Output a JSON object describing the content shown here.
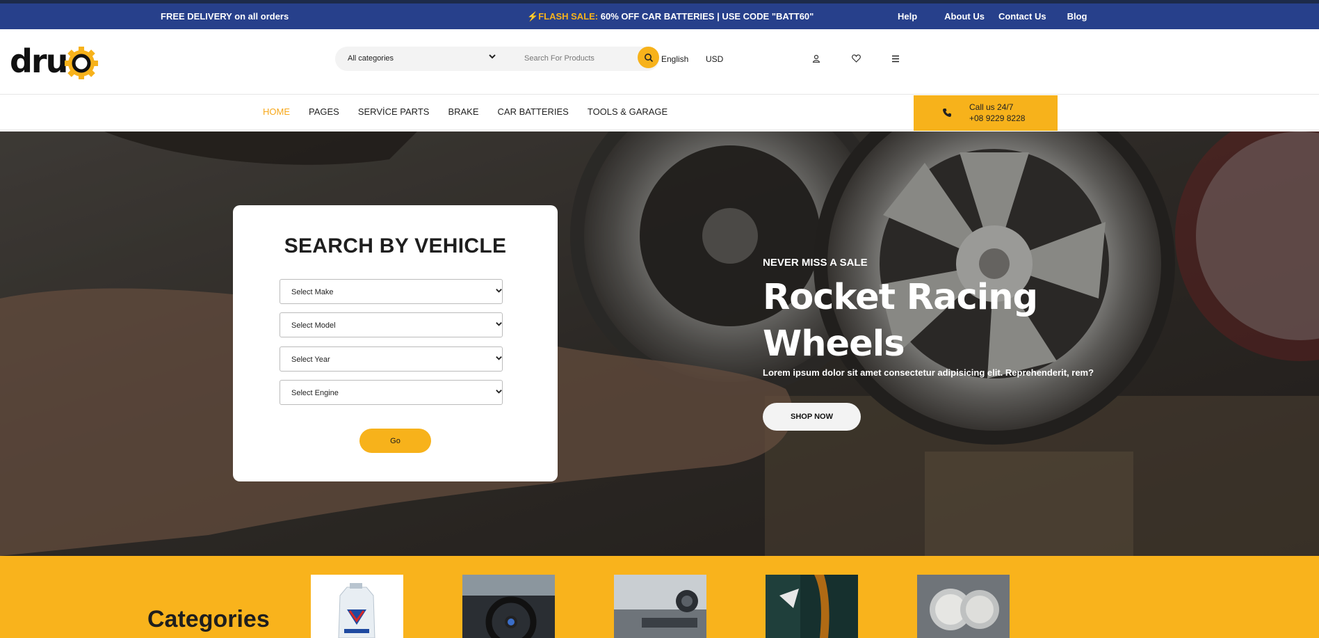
{
  "topbar": {
    "delivery": "FREE DELIVERY on all orders",
    "flash_label": "FLASH SALE:",
    "flash_text": " 60% OFF CAR BATTERIES | USE CODE \"BATT60\"",
    "links": [
      "Help",
      "About Us",
      "Contact Us",
      "Blog"
    ]
  },
  "header": {
    "logo": "druco",
    "category_select": "All categories",
    "search_placeholder": "Search For Products",
    "language": "English",
    "currency": "USD"
  },
  "nav": {
    "items": [
      "HOME",
      "PAGES",
      "SERVİCE PARTS",
      "BRAKE",
      "CAR BATTERIES",
      "TOOLS & GARAGE"
    ],
    "call_label": "Call us 24/7",
    "call_number": "+08 9229 8228"
  },
  "vehicle_search": {
    "title": "SEARCH BY VEHICLE",
    "selects": [
      "Select Make",
      "Select Model",
      "Select Year",
      "Select Engine"
    ],
    "go_label": "Go"
  },
  "hero": {
    "eyebrow": "NEVER MISS A SALE",
    "title_line1": "Rocket Racing",
    "title_line2": "Wheels",
    "description": "Lorem ipsum dolor sit amet consectetur adipisicing elit. Reprehenderit, rem?",
    "cta": "SHOP NOW"
  },
  "categories": {
    "heading": "Categories"
  },
  "colors": {
    "accent": "#f7b21b",
    "topbar": "#27408b"
  }
}
